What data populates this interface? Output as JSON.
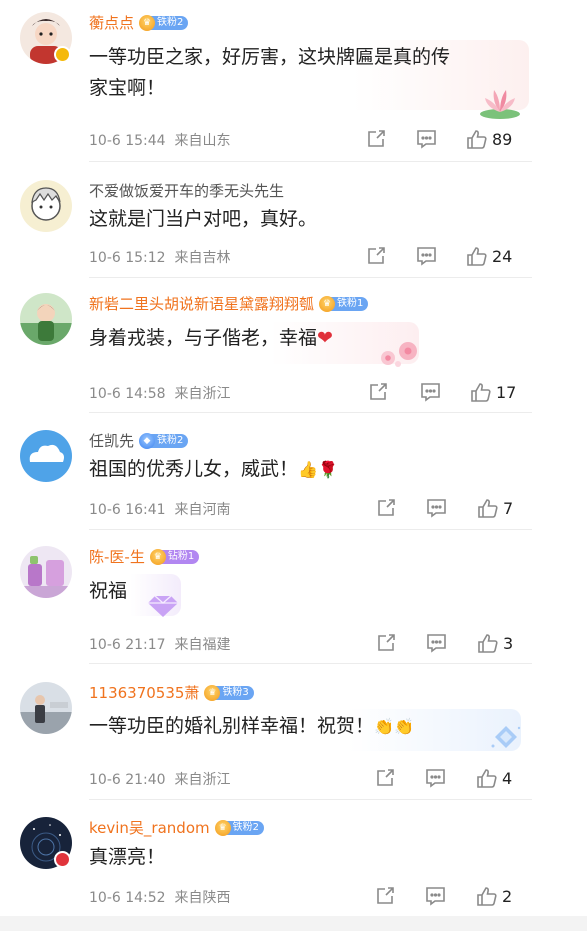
{
  "comments": [
    {
      "username": "蘅点点",
      "fan_badge": "铁粉2",
      "text_line1": "一等功臣之家，好厉害，这块牌匾是真的传",
      "text_line2": "家宝啊！",
      "date": "10-6 15:44",
      "location": "来自山东",
      "likes": "89",
      "verified_icon": "verified-v-icon"
    },
    {
      "username": "不爱做饭爱开车的季无头先生",
      "text": "这就是门当户对吧，真好。",
      "date": "10-6 15:12",
      "location": "来自吉林",
      "likes": "24"
    },
    {
      "username": "新砦二里头胡说新语星黛露翔翔瓠",
      "fan_badge": "铁粉1",
      "text": "身着戎装，与子偕老，幸福",
      "emoji": "red-heart-emoji",
      "date": "10-6 14:58",
      "location": "来自浙江",
      "likes": "17"
    },
    {
      "username": "任凯先",
      "fan_badge": "铁粉2",
      "text": "祖国的优秀儿女，威武！",
      "emojis": [
        "thumbs-up-emoji",
        "rose-emoji"
      ],
      "date": "10-6 16:41",
      "location": "来自河南",
      "likes": "7"
    },
    {
      "username": "陈-医-生",
      "fan_badge": "钻粉1",
      "text": "祝福",
      "date": "10-6 21:17",
      "location": "来自福建",
      "likes": "3"
    },
    {
      "username": "1136370535萧",
      "fan_badge": "铁粉3",
      "text": "一等功臣的婚礼别样幸福！祝贺！",
      "emojis": [
        "clap-emoji",
        "clap-emoji"
      ],
      "date": "10-6 21:40",
      "location": "来自浙江",
      "likes": "4"
    },
    {
      "username": "kevin吴_random",
      "fan_badge": "铁粉2",
      "text": "真漂亮！",
      "date": "10-6 14:52",
      "location": "来自陕西",
      "likes": "2"
    }
  ],
  "colors": {
    "vip_name": "#f0731e",
    "normal_name": "#555555",
    "meta": "#8a8a8a",
    "fan_badge": "#6aa5f3"
  },
  "icons": {
    "share": "share-icon",
    "comment": "comment-icon",
    "like": "like-thumb-icon"
  }
}
